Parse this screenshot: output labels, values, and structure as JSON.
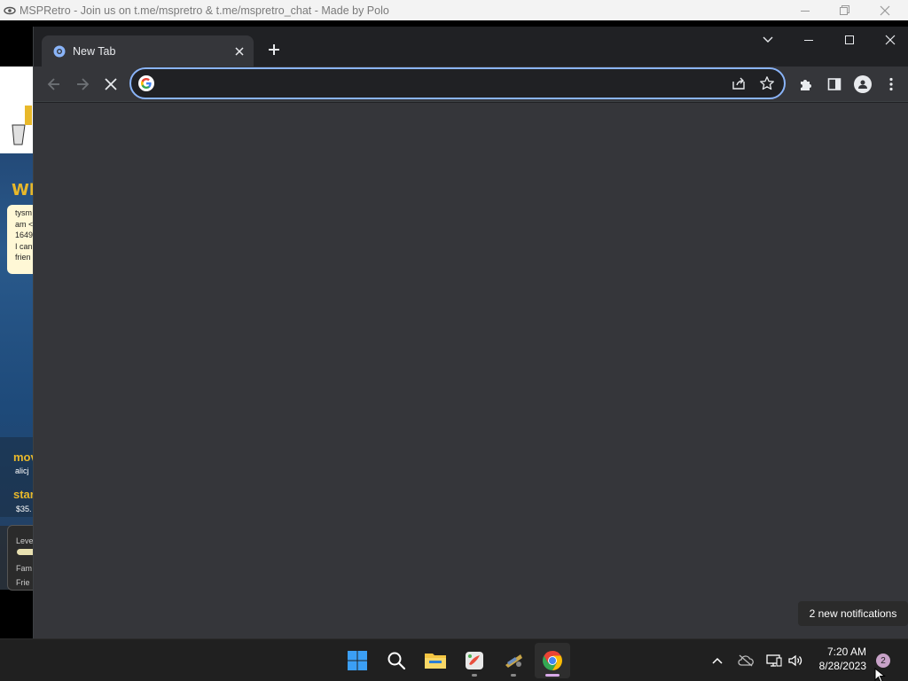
{
  "app_window": {
    "title": "MSPRetro - Join us on t.me/mspretro & t.me/mspretro_chat - Made by Polo",
    "icon": "mspretro-eye-icon",
    "controls": [
      "minimize",
      "maximize",
      "close"
    ]
  },
  "background_game": {
    "heading_partial": "Wh",
    "chat_lines": [
      "tysm",
      "am <",
      "1649",
      "I can",
      "frien"
    ],
    "movie_label": "mov",
    "user_partial": "alicj",
    "star_label": "star",
    "money_partial": "$35.",
    "level_partial": "Leve",
    "fame_partial": "Fam",
    "friends_partial": "Frie",
    "colors": {
      "gold": "#e8b82a",
      "note_bg": "#fff8d6",
      "bg_blue": "#1e4a7a"
    }
  },
  "browser": {
    "tabs": [
      {
        "title": "New Tab",
        "favicon": "chrome-favicon-icon",
        "close_icon": "close-icon"
      }
    ],
    "new_tab_icon": "plus-icon",
    "window_controls": [
      "chevron-down-icon",
      "minimize-icon",
      "maximize-icon",
      "close-icon"
    ],
    "toolbar": {
      "back_icon": "arrow-left-icon",
      "forward_icon": "arrow-right-icon",
      "stop_icon": "stop-x-icon",
      "omnibox_value": "",
      "omnibox_icon": "google-g-icon",
      "share_icon": "share-icon",
      "bookmark_icon": "star-icon",
      "extensions_icon": "puzzle-icon",
      "side_panel_icon": "side-panel-icon",
      "profile_icon": "person-icon",
      "menu_icon": "kebab-menu-icon"
    },
    "colors": {
      "frame": "#202124",
      "toolbar": "#35363a",
      "focus": "#8ab4f8",
      "text": "#e8eaed"
    }
  },
  "taskbar": {
    "pinned": [
      {
        "name": "start-button",
        "icon": "windows-logo-icon"
      },
      {
        "name": "search-button",
        "icon": "search-icon"
      },
      {
        "name": "file-explorer-button",
        "icon": "folder-icon"
      },
      {
        "name": "app-button-1",
        "icon": "paint-app-icon"
      },
      {
        "name": "app-button-2",
        "icon": "mspretro-app-icon"
      },
      {
        "name": "chrome-button",
        "icon": "chrome-icon",
        "active": true
      }
    ],
    "tray": {
      "chevron_icon": "chevron-up-icon",
      "onedrive_icon": "cloud-offline-icon",
      "network_icon": "network-icon",
      "volume_icon": "speaker-icon"
    },
    "clock": {
      "time": "7:20 AM",
      "date": "8/28/2023"
    },
    "notification_count": "2",
    "notification_toast": "2 new notifications"
  }
}
